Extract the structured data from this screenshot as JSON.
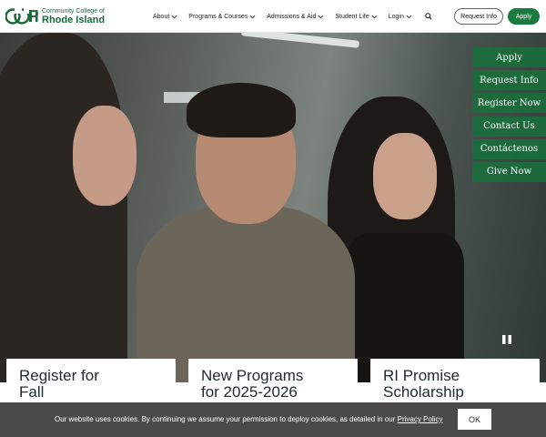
{
  "logo": {
    "mark": "CCRI",
    "line1": "Community College of",
    "line2": "Rhode Island"
  },
  "nav": {
    "items": [
      {
        "label": "About",
        "icon": "chevron-down-icon"
      },
      {
        "label": "Programs & Courses",
        "icon": "chevron-down-icon"
      },
      {
        "label": "Admissions & Aid",
        "icon": "chevron-down-icon"
      },
      {
        "label": "Student Life",
        "icon": "chevron-down-icon"
      },
      {
        "label": "Login",
        "icon": "chevron-down-icon"
      }
    ],
    "search_icon": "search-icon"
  },
  "header_buttons": {
    "request_info": "Request Info",
    "apply": "Apply"
  },
  "quick_links": [
    "Apply",
    "Request Info",
    "Register Now",
    "Contact Us",
    "Contáctenos",
    "Give Now"
  ],
  "hero": {
    "pause_icon": "pause-icon"
  },
  "cards": [
    {
      "line1": "Register for",
      "line2": "Fall"
    },
    {
      "line1": "New Programs",
      "line2": "for 2025-2026"
    },
    {
      "line1": "RI Promise",
      "line2": "Scholarship"
    }
  ],
  "cookie": {
    "text": "Our website uses cookies. By continuing we assume your permission to deploy cookies, as detailed in our",
    "link": "Privacy Policy",
    "button": "OK"
  },
  "colors": {
    "brand_green": "#1a7a3e",
    "quick_link_bg": "#1a6e3c",
    "cookie_bg": "#4a4a4a"
  }
}
